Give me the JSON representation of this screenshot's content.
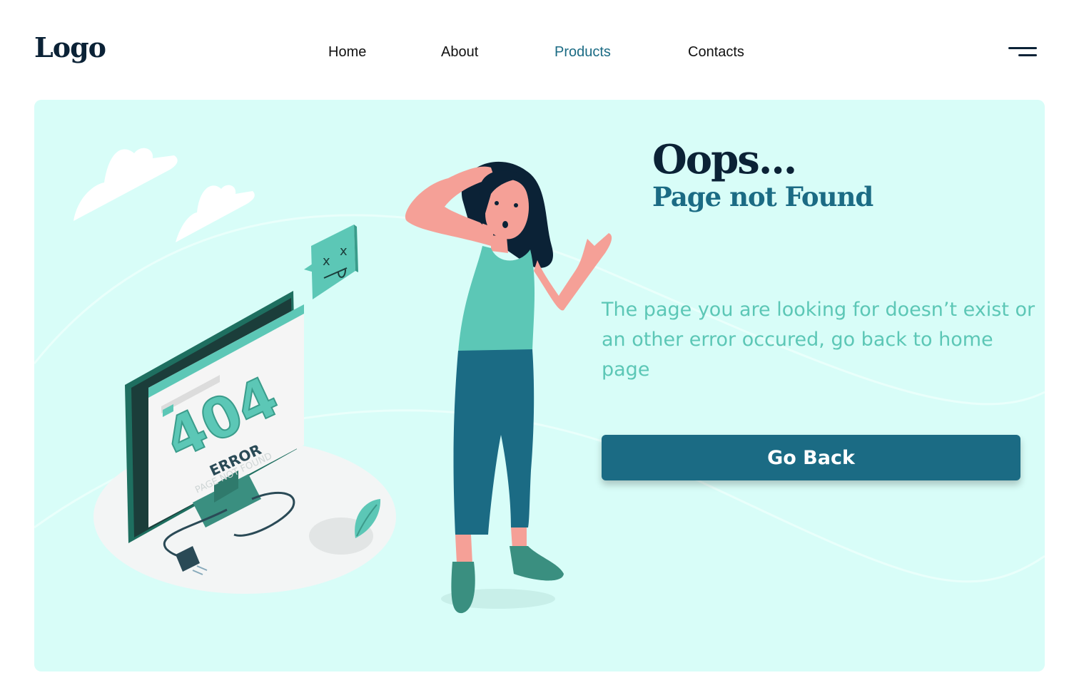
{
  "header": {
    "logo": "Logo",
    "nav": [
      {
        "label": "Home"
      },
      {
        "label": "About"
      },
      {
        "label": "Products"
      },
      {
        "label": "Contacts"
      }
    ],
    "active_nav": "Products",
    "menu_icon": "hamburger-menu-icon"
  },
  "hero": {
    "title": "Oops...",
    "subtitle": "Page not Found",
    "description": "The page you are looking for doesn’t exist or an other error occured, go back to home page",
    "button_label": "Go Back",
    "illustration": {
      "error_code": "404",
      "error_label": "ERROR",
      "error_sublabel": "PAGE NOT FOUND"
    }
  },
  "colors": {
    "background": "#ffffff",
    "hero_background": "#d8fdf8",
    "dark_navy": "#0b2236",
    "accent_teal": "#1b6b84",
    "light_teal": "#5cc7b6"
  }
}
